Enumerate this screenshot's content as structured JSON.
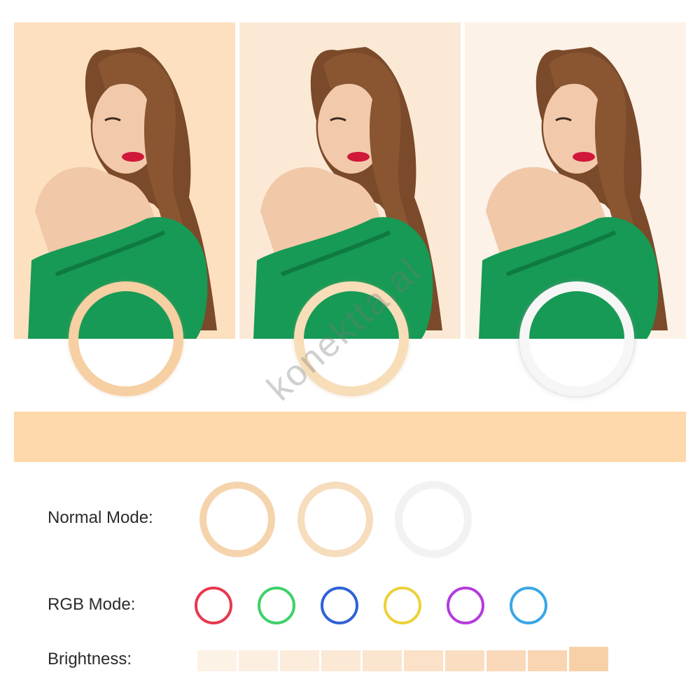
{
  "photos": [
    {
      "mode": "warm",
      "background": "#fde0c0",
      "ring_color": "#f6cfa2"
    },
    {
      "mode": "neutral",
      "background": "#fbe9d5",
      "ring_color": "#f7deb9"
    },
    {
      "mode": "cool",
      "background": "#fcf2e8",
      "ring_color": "#f6f6f6"
    }
  ],
  "watermark": "konektta.al",
  "normal_mode": {
    "label": "Normal Mode:",
    "rings": [
      "#f5d4ad",
      "#f6ddbd",
      "#f2f2f2"
    ]
  },
  "rgb_mode": {
    "label": "RGB Mode:",
    "rings": [
      "#e6384f",
      "#3ed168",
      "#2f62d7",
      "#ecd23a",
      "#b33ddc",
      "#3aa6e6"
    ]
  },
  "brightness": {
    "label": "Brightness:",
    "levels": 10,
    "colors": [
      "#fdf2e6",
      "#fcefe1",
      "#fcecdb",
      "#fbe8d5",
      "#fbe5cf",
      "#fae1c8",
      "#fadec2",
      "#fad9ba",
      "#f9d5b2",
      "#f8d0a8"
    ]
  },
  "colors": {
    "hair": "#7a4a2a",
    "dress": "#169a55",
    "skin": "#f1c8a8",
    "lips": "#d0183a",
    "peach_band": "#fdd9ab"
  }
}
